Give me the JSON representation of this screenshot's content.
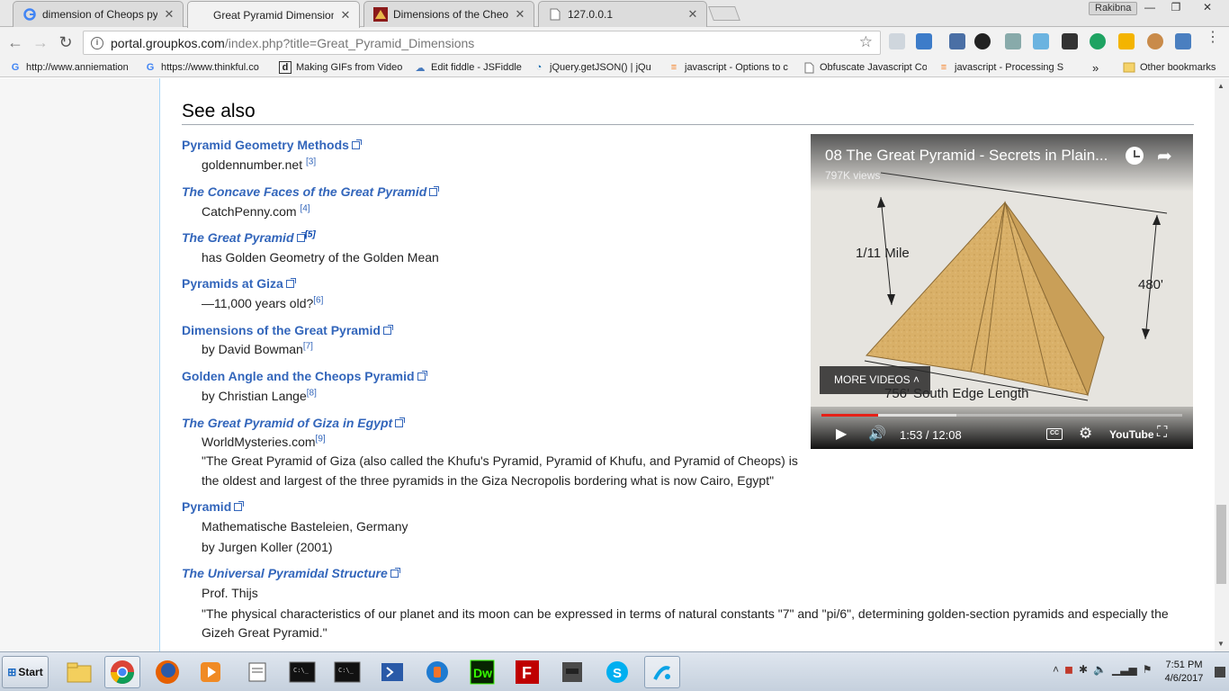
{
  "tabs": [
    {
      "title": "dimension of Cheops pyram",
      "favicon": "google-icon",
      "active": false
    },
    {
      "title": "Great Pyramid Dimensions",
      "favicon": "none",
      "active": true
    },
    {
      "title": "Dimensions of the Cheops",
      "favicon": "pyramid-icon",
      "active": false
    },
    {
      "title": "127.0.0.1",
      "favicon": "page-icon",
      "active": false
    }
  ],
  "profile_name": "Rakibna",
  "window_controls": {
    "minimize": "—",
    "maximize": "❐",
    "close": "✕"
  },
  "address": {
    "host": "portal.groupkos.com",
    "path": "/index.php?title=Great_Pyramid_Dimensions"
  },
  "bookmarks": [
    {
      "label": "http://www.anniemation",
      "icon": "google-icon"
    },
    {
      "label": "https://www.thinkful.co",
      "icon": "google-icon"
    },
    {
      "label": "Making GIFs from Video",
      "icon": "d-icon"
    },
    {
      "label": "Edit fiddle - JSFiddle",
      "icon": "jsfiddle-icon"
    },
    {
      "label": "jQuery.getJSON() | jQu",
      "icon": "jquery-icon"
    },
    {
      "label": "javascript - Options to c",
      "icon": "stackoverflow-icon"
    },
    {
      "label": "Obfuscate Javascript Co",
      "icon": "page-icon"
    },
    {
      "label": "javascript - Processing S",
      "icon": "stackoverflow-icon"
    }
  ],
  "bookmarks_overflow": "»",
  "other_bookmarks": "Other bookmarks",
  "section": {
    "heading": "See also"
  },
  "entries": [
    {
      "title": "Pyramid Geometry Methods",
      "italic": false,
      "lines": [
        {
          "text": "goldennumber.net ",
          "ref": "[3]"
        }
      ]
    },
    {
      "title": "The Concave Faces of the Great Pyramid",
      "italic": true,
      "lines": [
        {
          "text": "CatchPenny.com ",
          "ref": "[4]"
        }
      ]
    },
    {
      "title": "The Great Pyramid",
      "italic": true,
      "title_ref": "[5]",
      "lines": [
        {
          "text": "has Golden Geometry of the Golden Mean",
          "ref": ""
        }
      ]
    },
    {
      "title": "Pyramids at Giza",
      "italic": false,
      "lines": [
        {
          "text": "—11,000 years old?",
          "ref": "[6]"
        }
      ]
    },
    {
      "title": "Dimensions of the Great Pyramid",
      "italic": false,
      "lines": [
        {
          "text": "by David Bowman",
          "ref": "[7]"
        }
      ]
    },
    {
      "title": "Golden Angle and the Cheops Pyramid",
      "italic": false,
      "lines": [
        {
          "text": "by Christian Lange",
          "ref": "[8]"
        }
      ]
    },
    {
      "title": "The Great Pyramid of Giza in Egypt",
      "italic": true,
      "lines": [
        {
          "text": "WorldMysteries.com",
          "ref": "[9]"
        },
        {
          "text": "\"The Great Pyramid of Giza (also called the Khufu's Pyramid, Pyramid of Khufu, and Pyramid of Cheops) is",
          "ref": ""
        },
        {
          "text": "the oldest and largest of the three pyramids in the Giza Necropolis bordering what is now Cairo, Egypt\"",
          "ref": ""
        }
      ]
    },
    {
      "title": "Pyramid",
      "italic": false,
      "lines": [
        {
          "text": "Mathematische Basteleien, Germany",
          "ref": ""
        },
        {
          "text": "by Jurgen Koller (2001)",
          "ref": ""
        }
      ]
    },
    {
      "title": "The Universal Pyramidal Structure",
      "italic": true,
      "lines": [
        {
          "text": "Prof. Thijs",
          "ref": ""
        },
        {
          "text": "\"The physical characteristics of our planet and its moon can be expressed in terms of natural constants \"7\" and \"pi/6\", determining golden-section pyramids and especially the",
          "ref": ""
        },
        {
          "text": "Gizeh Great Pyramid.\"",
          "ref": ""
        }
      ]
    }
  ],
  "video": {
    "title": "08 The Great Pyramid - Secrets in Plain...",
    "views": "797K views",
    "labels": {
      "height_miles": "1/11 Mile",
      "height_feet": "480'",
      "base": "756' South Edge Length"
    },
    "more_videos": "MORE VIDEOS",
    "time": "1:53 / 12:08",
    "progress": 0.156,
    "brand": "YouTube"
  },
  "taskbar": {
    "start": "Start",
    "apps": [
      "file-explorer-icon",
      "chrome-icon",
      "firefox-icon",
      "media-player-icon",
      "notepad-icon",
      "cmd-icon",
      "cmd-icon",
      "powershell-icon",
      "app-icon",
      "dreamweaver-icon",
      "filezilla-icon",
      "game-icon",
      "skype-icon",
      "telenor-icon"
    ],
    "clock_time": "7:51 PM",
    "clock_date": "4/6/2017"
  }
}
